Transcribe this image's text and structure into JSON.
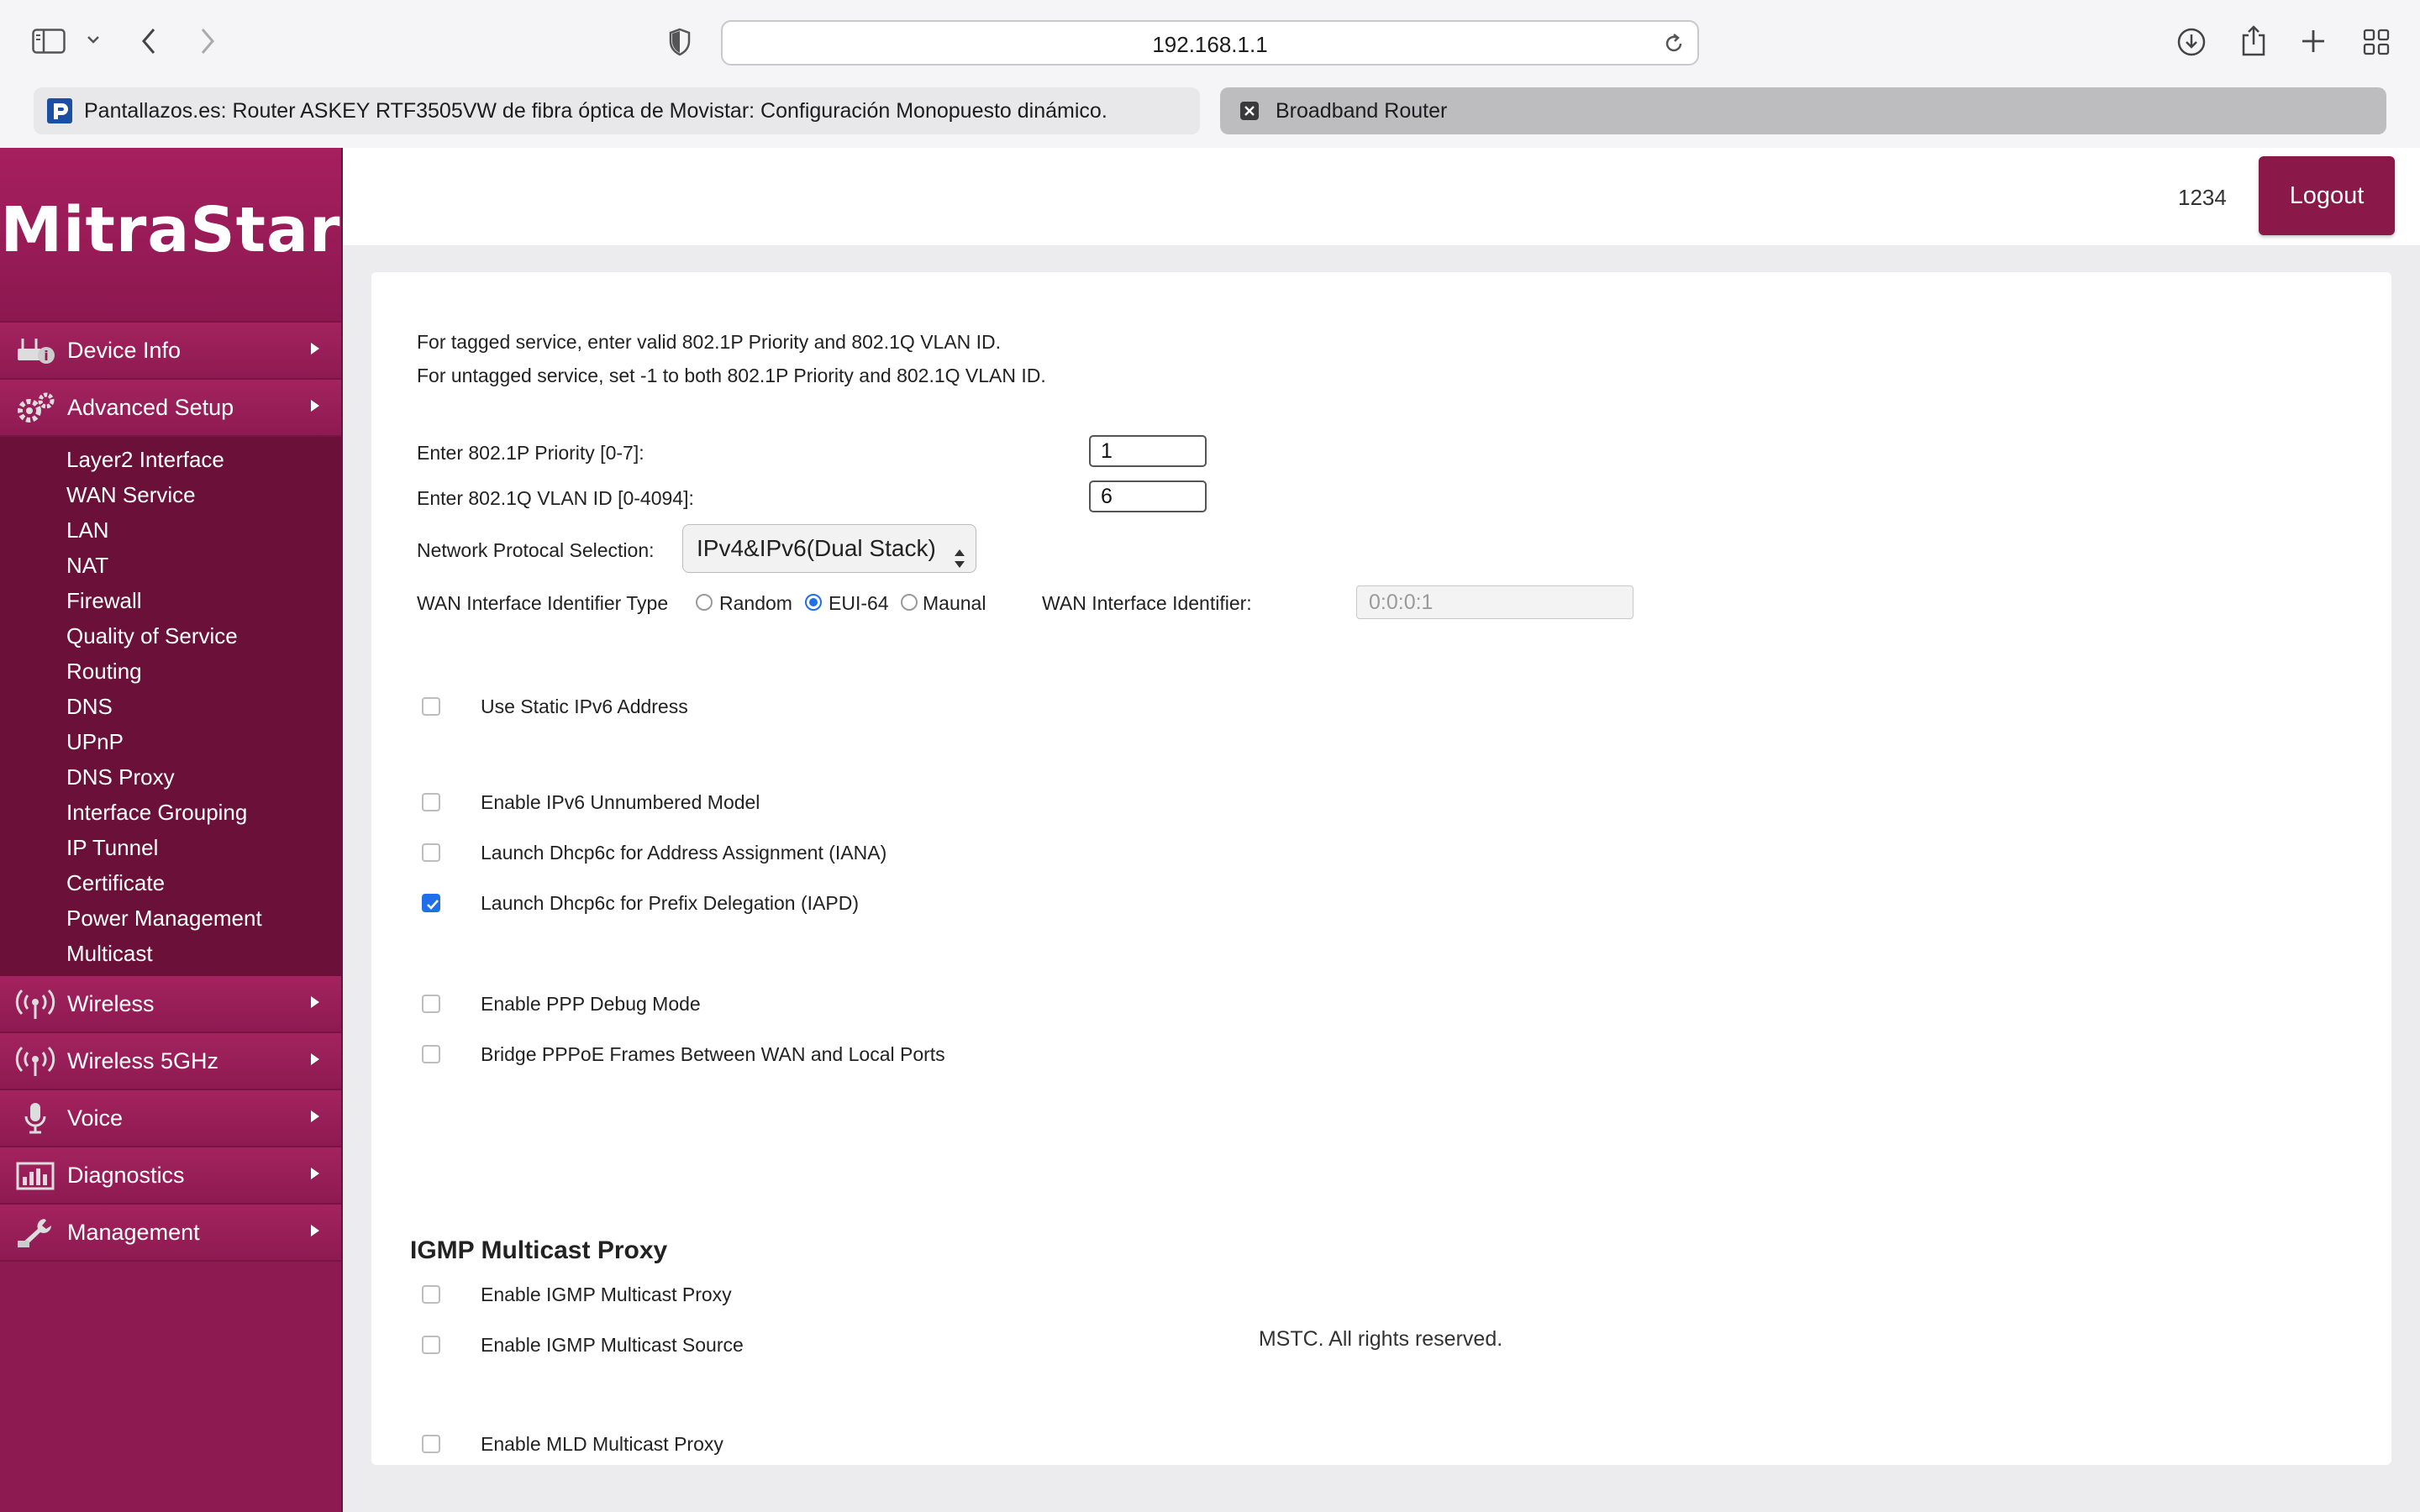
{
  "browser": {
    "address": "192.168.1.1",
    "tabs": [
      {
        "title": "Pantallazos.es: Router ASKEY RTF3505VW de fibra óptica de Movistar: Configuración Monopuesto dinámico."
      },
      {
        "title": "Broadband Router"
      }
    ]
  },
  "header": {
    "logo": "MitraStar",
    "user": "1234",
    "logout_label": "Logout"
  },
  "sidebar": {
    "device_info": "Device Info",
    "advanced_setup": "Advanced Setup",
    "submenu": [
      "Layer2 Interface",
      "WAN Service",
      "LAN",
      "NAT",
      "Firewall",
      "Quality of Service",
      "Routing",
      "DNS",
      "UPnP",
      "DNS Proxy",
      "Interface Grouping",
      "IP Tunnel",
      "Certificate",
      "Power Management",
      "Multicast"
    ],
    "wireless": "Wireless",
    "wireless_5g": "Wireless 5GHz",
    "voice": "Voice",
    "diagnostics": "Diagnostics",
    "management": "Management"
  },
  "form": {
    "intro_line1": "For tagged service, enter valid 802.1P Priority and 802.1Q VLAN ID.",
    "intro_line2": "For untagged service, set -1 to both 802.1P Priority and 802.1Q VLAN ID.",
    "priority_label": "Enter 802.1P Priority [0-7]:",
    "priority_value": "1",
    "vlan_label": "Enter 802.1Q VLAN ID [0-4094]:",
    "vlan_value": "6",
    "protocol_label": "Network Protocal Selection:",
    "protocol_value": "IPv4&IPv6(Dual Stack)",
    "wan_id_type_label": "WAN Interface Identifier Type",
    "radio_random": "Random",
    "radio_eui64": "EUI-64",
    "radio_manual": "Maunal",
    "wan_id_label": "WAN Interface Identifier:",
    "wan_id_placeholder": "0:0:0:1",
    "static_ipv6": "Use Static IPv6 Address",
    "ipv6_unnumbered": "Enable IPv6 Unnumbered Model",
    "dhcp6c_iana": "Launch Dhcp6c for Address Assignment (IANA)",
    "dhcp6c_iapd": "Launch Dhcp6c for Prefix Delegation (IAPD)",
    "ppp_debug": "Enable PPP Debug Mode",
    "bridge_pppoe": "Bridge PPPoE Frames Between WAN and Local Ports",
    "igmp_title": "IGMP Multicast Proxy",
    "igmp_proxy": "Enable IGMP Multicast Proxy",
    "igmp_source": "Enable IGMP Multicast Source",
    "mld_proxy": "Enable MLD Multicast Proxy"
  },
  "footer": "MSTC. All rights reserved.",
  "colors": {
    "brand": "#8e1a52",
    "accent": "#1f6fe8"
  }
}
